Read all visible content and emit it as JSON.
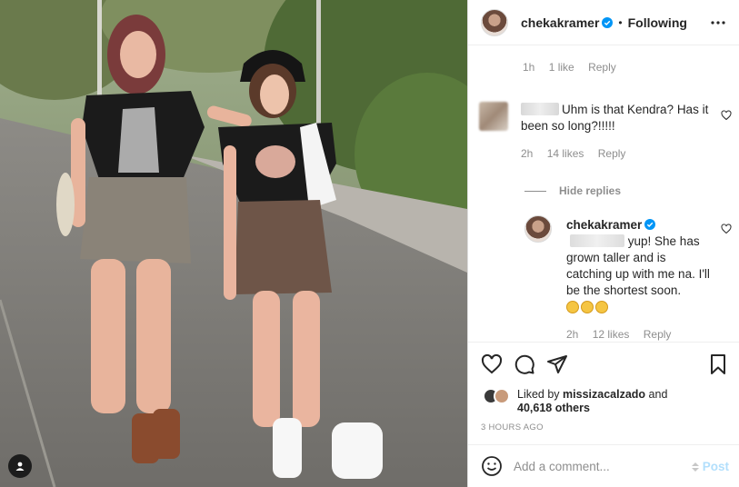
{
  "post": {
    "author": "chekakramer",
    "follow_status": "Following",
    "separator": "•"
  },
  "caption_meta": {
    "time": "1h",
    "likes": "1 like",
    "reply": "Reply"
  },
  "comments": [
    {
      "text": "Uhm is that Kendra? Has it been so long?!!!!!",
      "time": "2h",
      "likes": "14 likes",
      "reply": "Reply"
    }
  ],
  "hide_replies": "Hide replies",
  "replies": [
    {
      "username": "chekakramer",
      "text": "yup! She has grown taller and is catching up with me na. I'll be the shortest soon.",
      "time": "2h",
      "likes": "12 likes",
      "reply": "Reply"
    }
  ],
  "likes_summary": {
    "prefix": "Liked by",
    "user": "missizacalzado",
    "and": "and",
    "count": "40,618 others"
  },
  "timestamp": "3 HOURS AGO",
  "comment_input": {
    "placeholder": "Add a comment...",
    "post_label": "Post"
  },
  "icons": [
    "verified-icon",
    "more-icon",
    "heart-icon",
    "comment-icon",
    "share-icon",
    "bookmark-icon",
    "emoji-icon",
    "user-tag-icon"
  ],
  "colors": {
    "link_blue": "#0095f6",
    "post_disabled": "#b2dffc",
    "muted": "#8e8e8e",
    "text": "#262626"
  }
}
